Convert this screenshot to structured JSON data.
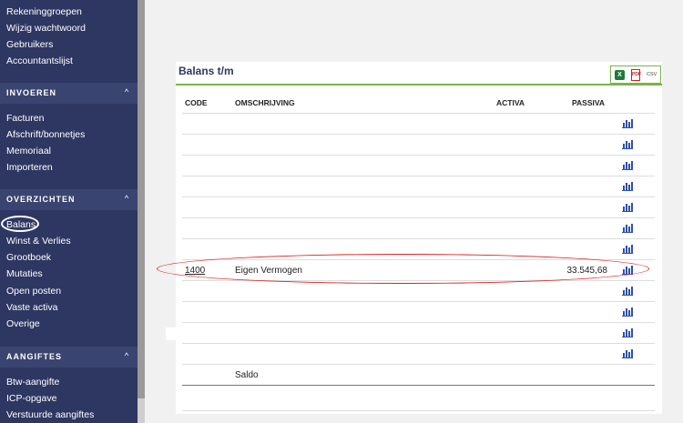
{
  "sidebar": {
    "top_items": [
      "Rekeninggroepen",
      "Wijzig wachtwoord",
      "Gebruikers",
      "Accountantslijst"
    ],
    "sections": [
      {
        "title": "INVOEREN",
        "items": [
          "Facturen",
          "Afschrift/bonnetjes",
          "Memoriaal",
          "Importeren"
        ]
      },
      {
        "title": "OVERZICHTEN",
        "items": [
          "Balans",
          "Winst & Verlies",
          "Grootboek",
          "Mutaties",
          "Open posten",
          "Vaste activa",
          "Overige"
        ]
      },
      {
        "title": "AANGIFTES",
        "items": [
          "Btw-aangifte",
          "ICP-opgave",
          "Verstuurde aangiftes"
        ]
      }
    ],
    "chevron": "^"
  },
  "panel": {
    "title": "Balans t/m",
    "export_icons": [
      "excel-icon",
      "pdf-icon",
      "csv-icon"
    ],
    "excel_glyph": "X",
    "pdf_glyph": "PDF",
    "csv_label": "CSV"
  },
  "table": {
    "headers": {
      "code": "CODE",
      "omschrijving": "OMSCHRIJVING",
      "activa": "ACTIVA",
      "passiva": "PASSIVA"
    },
    "rows": [
      {
        "code": "",
        "omschrijving": "",
        "activa": "",
        "passiva": "",
        "chart": true
      },
      {
        "code": "",
        "omschrijving": "",
        "activa": "",
        "passiva": "",
        "chart": true
      },
      {
        "code": "",
        "omschrijving": "",
        "activa": "",
        "passiva": "",
        "chart": true
      },
      {
        "code": "",
        "omschrijving": "",
        "activa": "",
        "passiva": "",
        "chart": true
      },
      {
        "code": "",
        "omschrijving": "",
        "activa": "",
        "passiva": "",
        "chart": true
      },
      {
        "code": "",
        "omschrijving": "",
        "activa": "",
        "passiva": "",
        "chart": true
      },
      {
        "code": "",
        "omschrijving": "",
        "activa": "",
        "passiva": "",
        "chart": true
      },
      {
        "code": "1400",
        "omschrijving": "Eigen Vermogen",
        "activa": "",
        "passiva": "33.545,68",
        "chart": true
      },
      {
        "code": "",
        "omschrijving": "",
        "activa": "",
        "passiva": "",
        "chart": true
      },
      {
        "code": "",
        "omschrijving": "",
        "activa": "",
        "passiva": "",
        "chart": true
      },
      {
        "code": "",
        "omschrijving": "",
        "activa": "",
        "passiva": "",
        "chart": true
      },
      {
        "code": "",
        "omschrijving": "",
        "activa": "",
        "passiva": "",
        "chart": true
      }
    ],
    "saldo_label": "Saldo"
  },
  "colors": {
    "sidebar": "#2e3762",
    "accent_green": "#78b44a",
    "chart_icon": "#2e4fb0",
    "annotation_red": "#dd2222"
  }
}
